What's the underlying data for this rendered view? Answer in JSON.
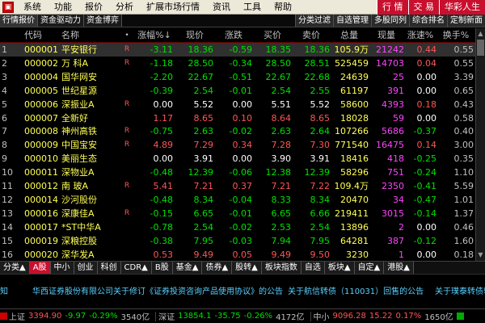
{
  "menu": {
    "items": [
      "系统",
      "功能",
      "报价",
      "分析",
      "扩展市场行情",
      "资讯",
      "工具",
      "帮助"
    ],
    "right_buttons": [
      "行 情",
      "交 易",
      "华彩人生"
    ]
  },
  "tabs": {
    "left": [
      "行情报价",
      "资金驱动力",
      "资金博弈"
    ],
    "right": [
      "分类过滤",
      "自选管理",
      "多股同列",
      "综合排名",
      "定制新面"
    ]
  },
  "table": {
    "headers": {
      "idx": "",
      "code": "代码",
      "name": "名称",
      "flag": "•",
      "chg": "涨幅%",
      "price": "现价",
      "diff": "涨跌",
      "buy": "买价",
      "sell": "卖价",
      "vol": "总量",
      "cur": "现量",
      "spd": "涨速%",
      "turn": "换手%"
    },
    "sort_mark": "↓",
    "rows": [
      {
        "idx": "1",
        "code": "000001",
        "name": "平安银行",
        "flag": "R",
        "chg": "-3.11",
        "price": "18.36",
        "diff": "-0.59",
        "buy": "18.35",
        "sell": "18.36",
        "vol": "105.9万",
        "cur": "21242",
        "spd": "0.44",
        "turn": "0.55",
        "dir": "down",
        "spd_dir": "up",
        "selected": true
      },
      {
        "idx": "2",
        "code": "000002",
        "name": "万 科A",
        "flag": "R",
        "chg": "-1.18",
        "price": "28.50",
        "diff": "-0.34",
        "buy": "28.50",
        "sell": "28.51",
        "vol": "525459",
        "cur": "14703",
        "spd": "0.04",
        "turn": "0.55",
        "dir": "down",
        "spd_dir": "up",
        "selected": false
      },
      {
        "idx": "3",
        "code": "000004",
        "name": "国华网安",
        "flag": "",
        "chg": "-2.20",
        "price": "22.67",
        "diff": "-0.51",
        "buy": "22.67",
        "sell": "22.68",
        "vol": "24639",
        "cur": "25",
        "spd": "0.00",
        "turn": "3.39",
        "dir": "down",
        "spd_dir": "flat",
        "selected": false
      },
      {
        "idx": "4",
        "code": "000005",
        "name": "世纪星源",
        "flag": "",
        "chg": "-0.39",
        "price": "2.54",
        "diff": "-0.01",
        "buy": "2.54",
        "sell": "2.55",
        "vol": "61197",
        "cur": "391",
        "spd": "0.00",
        "turn": "0.65",
        "dir": "down",
        "spd_dir": "flat",
        "selected": false
      },
      {
        "idx": "5",
        "code": "000006",
        "name": "深振业A",
        "flag": "R",
        "chg": "0.00",
        "price": "5.52",
        "diff": "0.00",
        "buy": "5.51",
        "sell": "5.52",
        "vol": "58600",
        "cur": "4393",
        "spd": "0.18",
        "turn": "0.43",
        "dir": "flat",
        "spd_dir": "up",
        "selected": false
      },
      {
        "idx": "6",
        "code": "000007",
        "name": "全新好",
        "flag": "",
        "chg": "1.17",
        "price": "8.65",
        "diff": "0.10",
        "buy": "8.64",
        "sell": "8.65",
        "vol": "18028",
        "cur": "59",
        "spd": "0.00",
        "turn": "0.58",
        "dir": "up",
        "spd_dir": "flat",
        "selected": false
      },
      {
        "idx": "7",
        "code": "000008",
        "name": "神州高铁",
        "flag": "R",
        "chg": "-0.75",
        "price": "2.63",
        "diff": "-0.02",
        "buy": "2.63",
        "sell": "2.64",
        "vol": "107266",
        "cur": "5686",
        "spd": "-0.37",
        "turn": "0.40",
        "dir": "down",
        "spd_dir": "down",
        "selected": false
      },
      {
        "idx": "8",
        "code": "000009",
        "name": "中国宝安",
        "flag": "R",
        "chg": "4.89",
        "price": "7.29",
        "diff": "0.34",
        "buy": "7.28",
        "sell": "7.30",
        "vol": "771540",
        "cur": "16475",
        "spd": "0.14",
        "turn": "3.00",
        "dir": "up",
        "spd_dir": "up",
        "selected": false
      },
      {
        "idx": "9",
        "code": "000010",
        "name": "美丽生态",
        "flag": "",
        "chg": "0.00",
        "price": "3.91",
        "diff": "0.00",
        "buy": "3.90",
        "sell": "3.91",
        "vol": "18416",
        "cur": "418",
        "spd": "-0.25",
        "turn": "0.35",
        "dir": "flat",
        "spd_dir": "down",
        "selected": false
      },
      {
        "idx": "10",
        "code": "000011",
        "name": "深物业A",
        "flag": "",
        "chg": "-0.48",
        "price": "12.39",
        "diff": "-0.06",
        "buy": "12.38",
        "sell": "12.39",
        "vol": "58296",
        "cur": "751",
        "spd": "-0.24",
        "turn": "1.10",
        "dir": "down",
        "spd_dir": "down",
        "selected": false
      },
      {
        "idx": "11",
        "code": "000012",
        "name": "南 玻A",
        "flag": "R",
        "chg": "5.41",
        "price": "7.21",
        "diff": "0.37",
        "buy": "7.21",
        "sell": "7.22",
        "vol": "109.4万",
        "cur": "2350",
        "spd": "-0.41",
        "turn": "5.59",
        "dir": "up",
        "spd_dir": "down",
        "selected": false
      },
      {
        "idx": "12",
        "code": "000014",
        "name": "沙河股份",
        "flag": "",
        "chg": "-0.48",
        "price": "8.34",
        "diff": "-0.04",
        "buy": "8.33",
        "sell": "8.34",
        "vol": "20470",
        "cur": "34",
        "spd": "-0.47",
        "turn": "1.01",
        "dir": "down",
        "spd_dir": "down",
        "selected": false
      },
      {
        "idx": "13",
        "code": "000016",
        "name": "深康佳A",
        "flag": "R",
        "chg": "-0.15",
        "price": "6.65",
        "diff": "-0.01",
        "buy": "6.65",
        "sell": "6.66",
        "vol": "219411",
        "cur": "3015",
        "spd": "-0.14",
        "turn": "1.37",
        "dir": "down",
        "spd_dir": "down",
        "selected": false
      },
      {
        "idx": "14",
        "code": "000017",
        "name": "*ST中华A",
        "flag": "",
        "chg": "-0.78",
        "price": "2.54",
        "diff": "-0.02",
        "buy": "2.53",
        "sell": "2.54",
        "vol": "13896",
        "cur": "2",
        "spd": "0.00",
        "turn": "0.46",
        "dir": "down",
        "spd_dir": "flat",
        "selected": false
      },
      {
        "idx": "15",
        "code": "000019",
        "name": "深粮控股",
        "flag": "",
        "chg": "-0.38",
        "price": "7.95",
        "diff": "-0.03",
        "buy": "7.94",
        "sell": "7.95",
        "vol": "64281",
        "cur": "387",
        "spd": "-0.12",
        "turn": "1.60",
        "dir": "down",
        "spd_dir": "down",
        "selected": false
      },
      {
        "idx": "16",
        "code": "000020",
        "name": "深华发A",
        "flag": "",
        "chg": "0.53",
        "price": "9.49",
        "diff": "0.05",
        "buy": "9.49",
        "sell": "9.50",
        "vol": "3230",
        "cur": "1",
        "spd": "0.00",
        "turn": "0.18",
        "dir": "up",
        "spd_dir": "flat",
        "selected": false
      }
    ]
  },
  "category_tabs": [
    {
      "label": "分类▲",
      "active": false
    },
    {
      "label": "A股",
      "active": true
    },
    {
      "label": "中小",
      "active": false
    },
    {
      "label": "创业",
      "active": false
    },
    {
      "label": "科创",
      "active": false
    },
    {
      "label": "CDR▲",
      "active": false
    },
    {
      "label": "B股",
      "active": false
    },
    {
      "label": "基金▲",
      "active": false
    },
    {
      "label": "债券▲",
      "active": false
    },
    {
      "label": "股转▲",
      "active": false
    },
    {
      "label": "板块指数",
      "active": false
    },
    {
      "label": "自选",
      "active": false
    },
    {
      "label": "板块▲",
      "active": false
    },
    {
      "label": "自定▲",
      "active": false
    },
    {
      "label": "港股▲",
      "active": false
    }
  ],
  "ticker": {
    "items": [
      "知",
      "华西证券股份有限公司关于修订《证券投资咨询产品使用协议》的公告",
      "关于航信转债（110031）回售的公告",
      "关于璞泰转债转股"
    ]
  },
  "status": {
    "sh": {
      "label": "上证",
      "value": "3394.90",
      "diff": "-9.97",
      "pct": "-0.29%",
      "amount": "3540亿"
    },
    "sz": {
      "label": "深证",
      "value": "13854.1",
      "diff": "-35.75",
      "pct": "-0.26%",
      "amount": "4172亿"
    },
    "zx": {
      "label": "中小",
      "value": "9096.28",
      "diff": "15.22",
      "pct": "0.17%",
      "amount": "1650亿"
    }
  }
}
